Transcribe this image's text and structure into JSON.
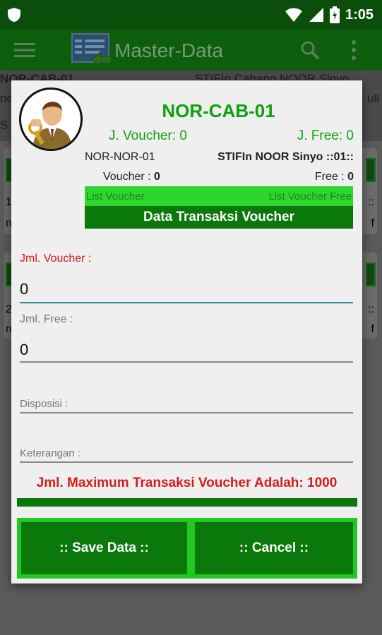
{
  "status_bar": {
    "time": "1:05"
  },
  "app_bar": {
    "title": "Master-Data"
  },
  "background_list": {
    "row1_left": "NOR-CAB-01",
    "row1_right": "STIFIn Cabang NOOR Sinyo",
    "row1_sub_left": "no",
    "row1_sub_right": "ull",
    "row1_line3": "S",
    "card1_line1": "1",
    "card1_line2": "n",
    "card1_right1": "::",
    "card1_right2": "f",
    "card2_line1": "2",
    "card2_line2": "n",
    "card2_right1": "::",
    "card2_right2": "f"
  },
  "dialog": {
    "code": "NOR-CAB-01",
    "j_voucher": "J. Voucher: 0",
    "j_free": "J. Free: 0",
    "nor_code": "NOR-NOR-01",
    "stifin_name": "STIFIn NOOR Sinyo ::01::",
    "voucher_label": "Voucher : ",
    "voucher_value": "0",
    "free_label": "Free : ",
    "free_value": "0",
    "list_voucher": "List Voucher",
    "list_voucher_free": "List Voucher Free",
    "data_transaksi": "Data Transaksi Voucher",
    "fields": {
      "jml_voucher_label": "Jml. Voucher :",
      "jml_voucher_value": "0",
      "jml_free_label": "Jml. Free :",
      "jml_free_value": "0",
      "disposisi_placeholder": "Disposisi :",
      "keterangan_placeholder": "Keterangan :"
    },
    "max_message": "Jml. Maximum Transaksi Voucher Adalah: 1000",
    "save_label": ":: Save Data ::",
    "cancel_label": ":: Cancel ::"
  },
  "colors": {
    "primary_dark": "#0b4e0b",
    "primary": "#0a780a",
    "accent_green": "#0ca20c",
    "bright_green": "#22c822",
    "error_red": "#d81c1c",
    "focus_teal": "#2a8f8f"
  },
  "icons": [
    "shield-icon",
    "wifi-icon",
    "signal-icon",
    "battery-icon",
    "menu-icon",
    "master-data-logo-icon",
    "search-icon",
    "more-vert-icon",
    "user-key-avatar-icon"
  ]
}
